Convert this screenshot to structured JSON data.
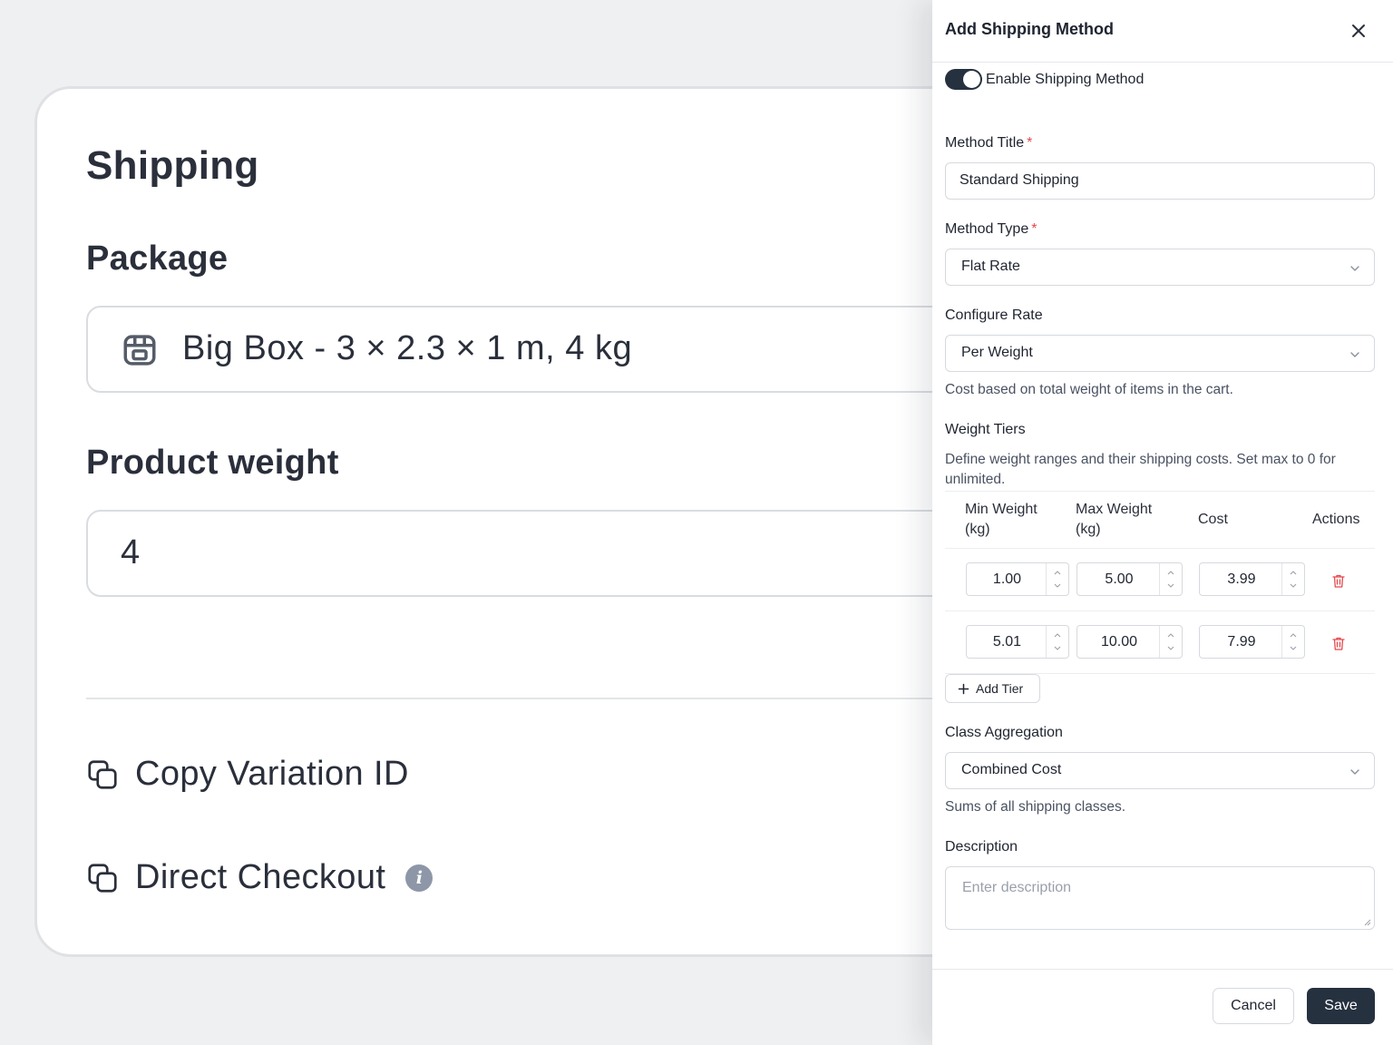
{
  "background": {
    "heading": "Shipping",
    "package_label": "Package",
    "package_value": "Big Box - 3 × 2.3 × 1 m, 4 kg",
    "weight_label": "Product weight",
    "weight_value": "4",
    "copy_variation_label": "Copy Variation ID",
    "direct_checkout_label": "Direct Checkout"
  },
  "drawer": {
    "title": "Add Shipping Method",
    "enable_label": "Enable Shipping Method",
    "enabled": true,
    "method_title_label": "Method Title",
    "method_title_value": "Standard Shipping",
    "method_type_label": "Method Type",
    "method_type_value": "Flat Rate",
    "configure_rate_label": "Configure Rate",
    "configure_rate_value": "Per Weight",
    "configure_rate_help": "Cost based on total weight of items in the cart.",
    "weight_tiers_label": "Weight Tiers",
    "weight_tiers_help": "Define weight ranges and their shipping costs. Set max to 0 for unlimited.",
    "table_headers": {
      "min_weight": "Min Weight (kg)",
      "max_weight": "Max Weight (kg)",
      "cost": "Cost",
      "actions": "Actions"
    },
    "tiers": [
      {
        "min": "1.00",
        "max": "5.00",
        "cost": "3.99"
      },
      {
        "min": "5.01",
        "max": "10.00",
        "cost": "7.99"
      }
    ],
    "add_tier_label": "Add Tier",
    "class_aggregation_label": "Class Aggregation",
    "class_aggregation_value": "Combined Cost",
    "class_aggregation_help": "Sums of all shipping classes.",
    "description_label": "Description",
    "description_placeholder": "Enter description",
    "cancel_label": "Cancel",
    "save_label": "Save"
  },
  "colors": {
    "primary": "#263140",
    "required": "#e5484d",
    "danger": "#e5484d",
    "border": "#d6d9de"
  },
  "icons": [
    "package-icon",
    "copy-icon",
    "info-icon",
    "close-icon",
    "chevron-down-icon",
    "chevron-up-icon",
    "trash-icon",
    "plus-icon"
  ]
}
